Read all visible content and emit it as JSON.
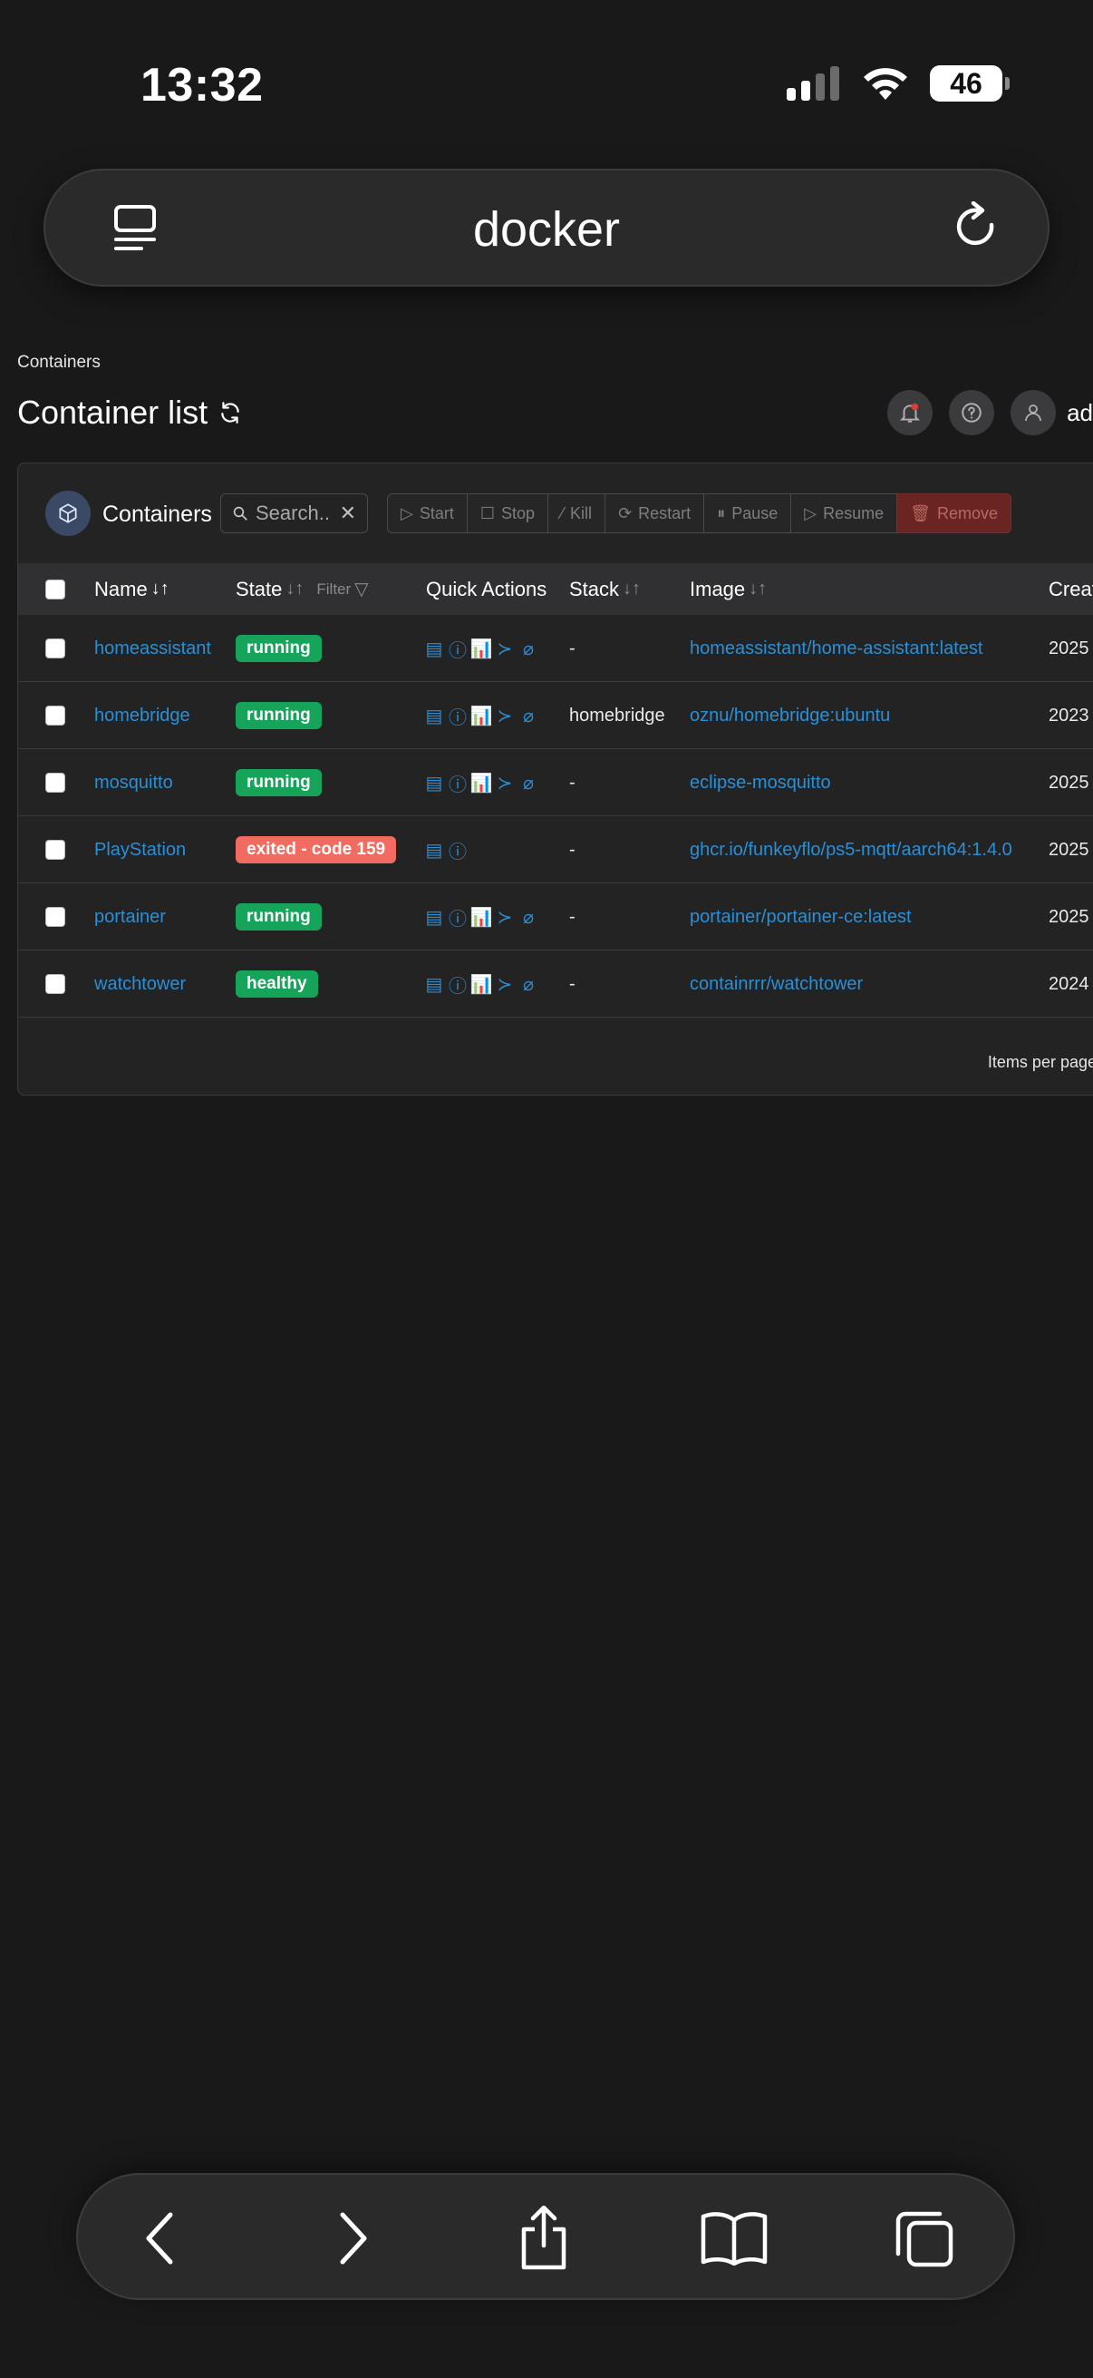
{
  "status": {
    "time": "13:32",
    "battery": "46"
  },
  "browser": {
    "url": "docker"
  },
  "page": {
    "breadcrumb": "Containers",
    "title": "Container list",
    "user": "ad"
  },
  "card": {
    "title": "Containers",
    "search_placeholder": "Search..",
    "actions": [
      "Start",
      "Stop",
      "Kill",
      "Restart",
      "Pause",
      "Resume",
      "Remove"
    ],
    "columns": {
      "name": "Name",
      "state": "State",
      "filter": "Filter",
      "quick_actions": "Quick Actions",
      "stack": "Stack",
      "image": "Image",
      "created": "Creat"
    },
    "rows": [
      {
        "name": "homeassistant",
        "state": "running",
        "stack": "-",
        "image": "homeassistant/home-assistant:latest",
        "created": "2025"
      },
      {
        "name": "homebridge",
        "state": "running",
        "stack": "homebridge",
        "image": "oznu/homebridge:ubuntu",
        "created": "2023"
      },
      {
        "name": "mosquitto",
        "state": "running",
        "stack": "-",
        "image": "eclipse-mosquitto",
        "created": "2025"
      },
      {
        "name": "PlayStation",
        "state": "exited - code 159",
        "stack": "-",
        "image": "ghcr.io/funkeyflo/ps5-mqtt/aarch64:1.4.0",
        "created": "2025"
      },
      {
        "name": "portainer",
        "state": "running",
        "stack": "-",
        "image": "portainer/portainer-ce:latest",
        "created": "2025"
      },
      {
        "name": "watchtower",
        "state": "healthy",
        "stack": "-",
        "image": "containrrr/watchtower",
        "created": "2024"
      }
    ],
    "items_per_page": "Items per page"
  },
  "colors": {
    "running": "#16a35a",
    "exited": "#f26b61",
    "link": "#2b8fd6",
    "remove": "#6a2422"
  }
}
